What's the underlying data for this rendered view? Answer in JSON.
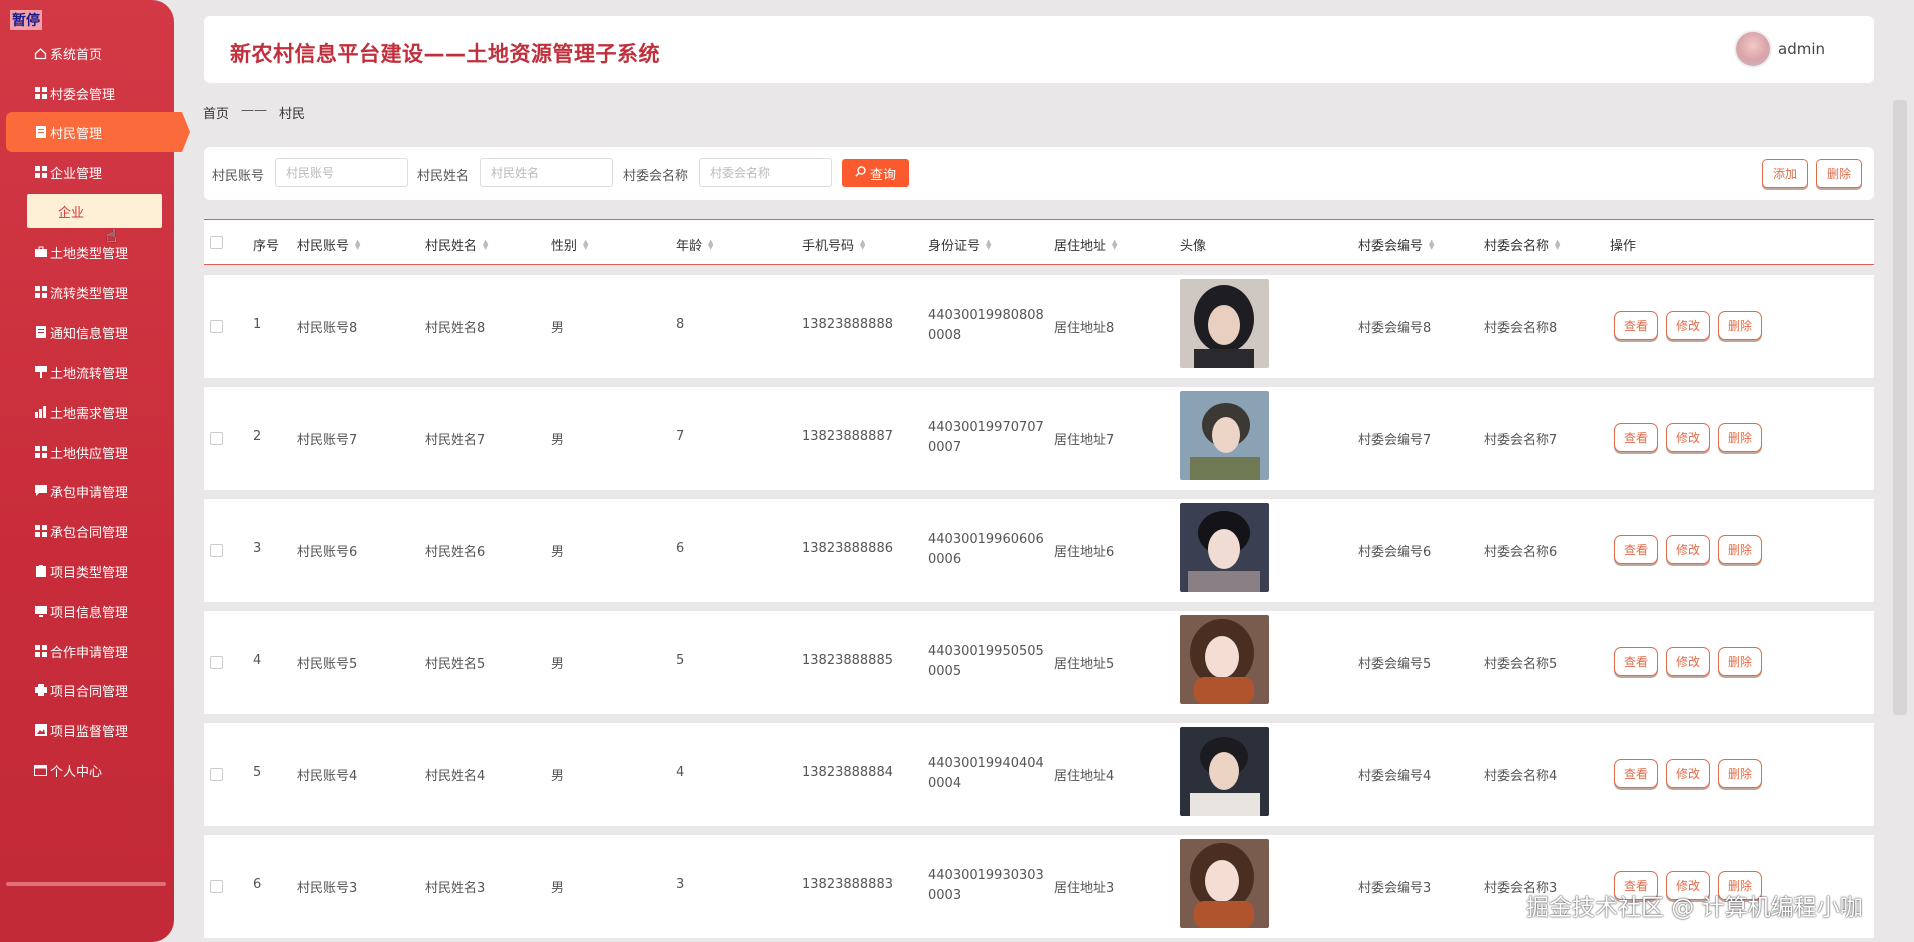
{
  "sidebar": {
    "pause_label": "暂停",
    "menu": [
      {
        "label": "系统首页",
        "icon": "home-icon"
      },
      {
        "label": "村委会管理",
        "icon": "grid-icon"
      },
      {
        "label": "村民管理",
        "icon": "document-icon"
      },
      {
        "label": "企业管理",
        "icon": "grid-icon"
      },
      {
        "label": "土地类型管理",
        "icon": "briefcase-icon"
      },
      {
        "label": "流转类型管理",
        "icon": "grid-icon"
      },
      {
        "label": "通知信息管理",
        "icon": "document-icon"
      },
      {
        "label": "土地流转管理",
        "icon": "flag-icon"
      },
      {
        "label": "土地需求管理",
        "icon": "chart-icon"
      },
      {
        "label": "土地供应管理",
        "icon": "grid-icon"
      },
      {
        "label": "承包申请管理",
        "icon": "chat-icon"
      },
      {
        "label": "承包合同管理",
        "icon": "grid-icon"
      },
      {
        "label": "项目类型管理",
        "icon": "clipboard-icon"
      },
      {
        "label": "项目信息管理",
        "icon": "monitor-icon"
      },
      {
        "label": "合作申请管理",
        "icon": "grid-icon"
      },
      {
        "label": "项目合同管理",
        "icon": "printer-icon"
      },
      {
        "label": "项目监督管理",
        "icon": "image-icon"
      },
      {
        "label": "个人中心",
        "icon": "calendar-icon"
      }
    ],
    "active_index": 2,
    "submenu_label": "企业"
  },
  "header": {
    "title": "新农村信息平台建设——土地资源管理子系统",
    "username": "admin"
  },
  "breadcrumb": {
    "home": "首页",
    "separator": "——",
    "current": "村民"
  },
  "search": {
    "account_label": "村民账号",
    "account_placeholder": "村民账号",
    "name_label": "村民姓名",
    "name_placeholder": "村民姓名",
    "committee_label": "村委会名称",
    "committee_placeholder": "村委会名称",
    "query_label": "查询",
    "add_label": "添加",
    "delete_label": "删除"
  },
  "table": {
    "columns": [
      "序号",
      "村民账号",
      "村民姓名",
      "性别",
      "年龄",
      "手机号码",
      "身份证号",
      "居住地址",
      "头像",
      "村委会编号",
      "村委会名称",
      "操作"
    ],
    "rows": [
      {
        "index": "1",
        "account": "村民账号8",
        "name": "村民姓名8",
        "gender": "男",
        "age": "8",
        "phone": "13823888888",
        "idcard": "440300199808080008",
        "address": "居住地址8",
        "committee_no": "村委会编号8",
        "committee_name": "村委会名称8"
      },
      {
        "index": "2",
        "account": "村民账号7",
        "name": "村民姓名7",
        "gender": "男",
        "age": "7",
        "phone": "13823888887",
        "idcard": "440300199707070007",
        "address": "居住地址7",
        "committee_no": "村委会编号7",
        "committee_name": "村委会名称7"
      },
      {
        "index": "3",
        "account": "村民账号6",
        "name": "村民姓名6",
        "gender": "男",
        "age": "6",
        "phone": "13823888886",
        "idcard": "440300199606060006",
        "address": "居住地址6",
        "committee_no": "村委会编号6",
        "committee_name": "村委会名称6"
      },
      {
        "index": "4",
        "account": "村民账号5",
        "name": "村民姓名5",
        "gender": "男",
        "age": "5",
        "phone": "13823888885",
        "idcard": "440300199505050005",
        "address": "居住地址5",
        "committee_no": "村委会编号5",
        "committee_name": "村委会名称5"
      },
      {
        "index": "5",
        "account": "村民账号4",
        "name": "村民姓名4",
        "gender": "男",
        "age": "4",
        "phone": "13823888884",
        "idcard": "440300199404040004",
        "address": "居住地址4",
        "committee_no": "村委会编号4",
        "committee_name": "村委会名称4"
      },
      {
        "index": "6",
        "account": "村民账号3",
        "name": "村民姓名3",
        "gender": "男",
        "age": "3",
        "phone": "13823888883",
        "idcard": "440300199303030003",
        "address": "居住地址3",
        "committee_no": "村委会编号3",
        "committee_name": "村委会名称3"
      }
    ],
    "actions": {
      "view": "查看",
      "edit": "修改",
      "delete": "删除"
    }
  },
  "watermark": "掘金技术社区 @ 计算机编程小咖",
  "colors": {
    "sidebar": "#c82c3a",
    "active_menu": "#fb6a3a",
    "accent": "#e06c4a",
    "title": "#c0303c"
  }
}
